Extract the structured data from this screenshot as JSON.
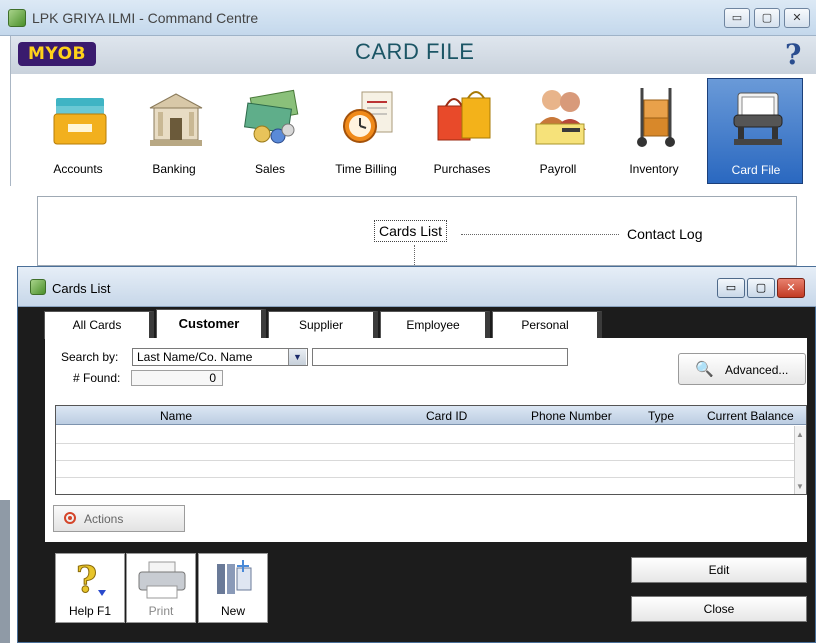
{
  "window": {
    "title": "LPK GRIYA ILMI - Command Centre",
    "controls": {
      "minimize": "▭",
      "maximize": "▢",
      "close": "✕"
    }
  },
  "header": {
    "logo": "MYOB",
    "page_title": "CARD FILE",
    "help_glyph": "?"
  },
  "modules": [
    {
      "label": "Accounts",
      "icon": "folder-icon"
    },
    {
      "label": "Banking",
      "icon": "bank-icon"
    },
    {
      "label": "Sales",
      "icon": "money-icon"
    },
    {
      "label": "Time Billing",
      "icon": "clock-invoice-icon"
    },
    {
      "label": "Purchases",
      "icon": "shopping-bags-icon"
    },
    {
      "label": "Payroll",
      "icon": "people-check-icon"
    },
    {
      "label": "Inventory",
      "icon": "hand-truck-icon"
    },
    {
      "label": "Card File",
      "icon": "rolodex-icon",
      "active": true
    }
  ],
  "flow": {
    "cards_list": "Cards List",
    "contact_log": "Contact Log"
  },
  "dialog": {
    "title": "Cards List",
    "controls": {
      "minimize": "▭",
      "maximize": "▢",
      "close": "✕"
    },
    "tabs": [
      {
        "label": "All Cards"
      },
      {
        "label": "Customer",
        "active": true
      },
      {
        "label": "Supplier"
      },
      {
        "label": "Employee"
      },
      {
        "label": "Personal"
      }
    ],
    "search": {
      "label": "Search by:",
      "selected": "Last Name/Co. Name",
      "value": "",
      "found_label": "# Found:",
      "found_count": "0",
      "advanced_label": "Advanced..."
    },
    "table": {
      "columns": [
        "Name",
        "Card ID",
        "Phone Number",
        "Type",
        "Current Balance"
      ],
      "rows": []
    },
    "actions_label": "Actions",
    "toolbar": {
      "help": "Help F1",
      "print": "Print",
      "new": "New"
    },
    "edit_label": "Edit",
    "close_label": "Close"
  },
  "colors": {
    "title_accent": "#1b5565",
    "active_module": "#2a68c0",
    "dialog_background": "#1c1c1c"
  }
}
